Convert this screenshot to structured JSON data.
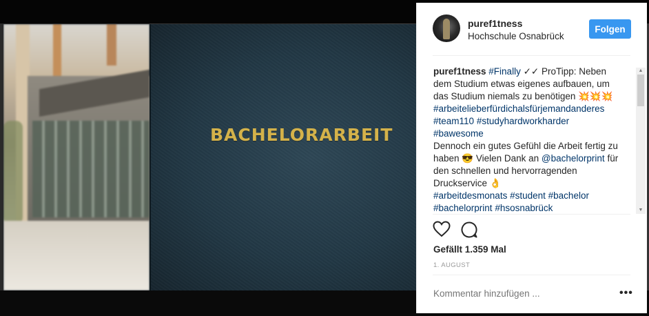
{
  "photo": {
    "book_title": "BACHELORARBEIT"
  },
  "post": {
    "username": "puref1tness",
    "location": "Hochschule Osnabrück",
    "follow_label": "Folgen",
    "caption": {
      "author": "puref1tness",
      "line1_tag": "#Finally",
      "line1_text": " ✓✓ ProTipp: Neben dem Studium etwas eigenes aufbauen, um das Studium niemals zu benötigen 💥💥💥",
      "tags1": [
        "#arbeitelieberfürdichalsfürjemandanderes",
        "#team110",
        "#studyhardworkharder",
        "#bawesome"
      ],
      "text2a": "Dennoch ein gutes Gefühl die Arbeit fertig zu haben 😎 Vielen Dank an ",
      "mention": "@bachelorprint",
      "text2b": " für den schnellen und hervorragenden Druckservice 👌",
      "tags2": [
        "#arbeitdesmonats",
        "#student",
        "#bachelor",
        "#bachelorprint",
        "#hsosnabrück"
      ]
    },
    "icons": {
      "like": "heart-icon",
      "comment": "comment-icon"
    },
    "likes_text": "Gefällt 1.359 Mal",
    "date": "1. AUGUST",
    "comment_placeholder": "Kommentar hinzufügen ...",
    "more_label": "•••"
  }
}
